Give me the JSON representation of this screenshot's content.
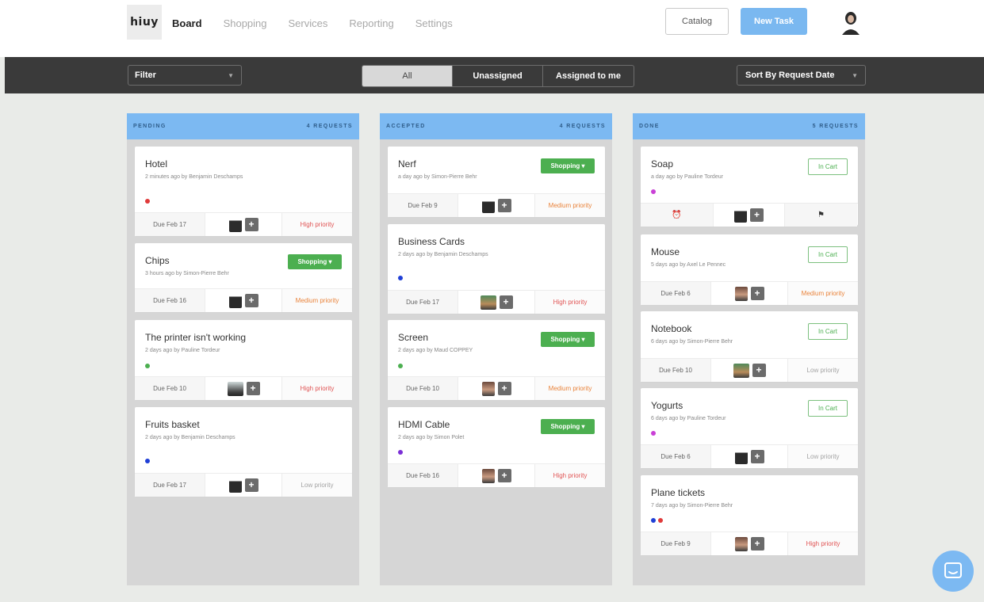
{
  "app": {
    "logo": "hiuy",
    "nav": [
      "Board",
      "Shopping",
      "Services",
      "Reporting",
      "Settings"
    ],
    "catalog_label": "Catalog",
    "new_task_label": "New Task"
  },
  "filterbar": {
    "filter_label": "Filter",
    "segments": [
      "All",
      "Unassigned",
      "Assigned to me"
    ],
    "sort_label": "Sort By Request Date"
  },
  "columns": [
    {
      "name": "PENDING",
      "count_label": "4 REQUESTS",
      "cards": [
        {
          "title": "Hotel",
          "meta": "2 minutes ago by Benjamin Deschamps",
          "dots": [
            "#e03a3a"
          ],
          "tag": "",
          "due": "Due Feb 17",
          "priority": "High priority",
          "priority_level": "high",
          "avatar": "woman"
        },
        {
          "title": "Chips",
          "meta": "3 hours ago by Simon-Pierre Behr",
          "dots": [],
          "tag": "Shopping ▾",
          "due": "Due Feb 16",
          "priority": "Medium priority",
          "priority_level": "med",
          "avatar": "woman"
        },
        {
          "title": "The printer isn't working",
          "meta": "2 days ago by Pauline Tordeur",
          "dots": [
            "#4caf50"
          ],
          "tag": "",
          "due": "Due Feb 10",
          "priority": "High priority",
          "priority_level": "high",
          "avatar": "printer"
        },
        {
          "title": "Fruits basket",
          "meta": "2 days ago by Benjamin Deschamps",
          "dots": [
            "#1f3fd6"
          ],
          "tag": "",
          "due": "Due Feb 17",
          "priority": "Low priority",
          "priority_level": "low",
          "avatar": "woman"
        }
      ]
    },
    {
      "name": "ACCEPTED",
      "count_label": "4 REQUESTS",
      "cards": [
        {
          "title": "Nerf",
          "meta": "a day ago by Simon-Pierre Behr",
          "dots": [],
          "tag": "Shopping ▾",
          "due": "Due Feb 9",
          "priority": "Medium priority",
          "priority_level": "med",
          "avatar": "woman"
        },
        {
          "title": "Business Cards",
          "meta": "2 days ago by Benjamin Deschamps",
          "dots": [
            "#1f3fd6"
          ],
          "tag": "",
          "due": "Due Feb 17",
          "priority": "High priority",
          "priority_level": "high",
          "avatar": "photo"
        },
        {
          "title": "Screen",
          "meta": "2 days ago by Maud COPPEY",
          "dots": [
            "#4caf50"
          ],
          "tag": "Shopping ▾",
          "due": "Due Feb 10",
          "priority": "Medium priority",
          "priority_level": "med",
          "avatar": "man"
        },
        {
          "title": "HDMI Cable",
          "meta": "2 days ago by Simon Polet",
          "dots": [
            "#7b2fd6"
          ],
          "tag": "Shopping ▾",
          "due": "Due Feb 16",
          "priority": "High priority",
          "priority_level": "high",
          "avatar": "man"
        }
      ]
    },
    {
      "name": "DONE",
      "count_label": "5 REQUESTS",
      "cards": [
        {
          "title": "Soap",
          "meta": "a day ago by Pauline Tordeur",
          "dots": [
            "#c940d6"
          ],
          "tag_incart": "In Cart",
          "footer_icons": [
            "⏰",
            "⚑"
          ],
          "avatar": "woman"
        },
        {
          "title": "Mouse",
          "meta": "5 days ago by Axel Le Pennec",
          "dots": [],
          "tag_incart": "In Cart",
          "due": "Due Feb 6",
          "priority": "Medium priority",
          "priority_level": "med",
          "avatar": "man"
        },
        {
          "title": "Notebook",
          "meta": "6 days ago by Simon-Pierre Behr",
          "dots": [],
          "tag_incart": "In Cart",
          "due": "Due Feb 10",
          "priority": "Low priority",
          "priority_level": "low",
          "avatar": "photo"
        },
        {
          "title": "Yogurts",
          "meta": "6 days ago by Pauline Tordeur",
          "dots": [
            "#c940d6"
          ],
          "tag_incart": "In Cart",
          "due": "Due Feb 6",
          "priority": "Low priority",
          "priority_level": "low",
          "avatar": "woman"
        },
        {
          "title": "Plane tickets",
          "meta": "7 days ago by Simon-Pierre Behr",
          "dots": [
            "#1f3fd6",
            "#e03a3a"
          ],
          "due": "Due Feb 9",
          "priority": "High priority",
          "priority_level": "high",
          "avatar": "man"
        }
      ]
    }
  ]
}
